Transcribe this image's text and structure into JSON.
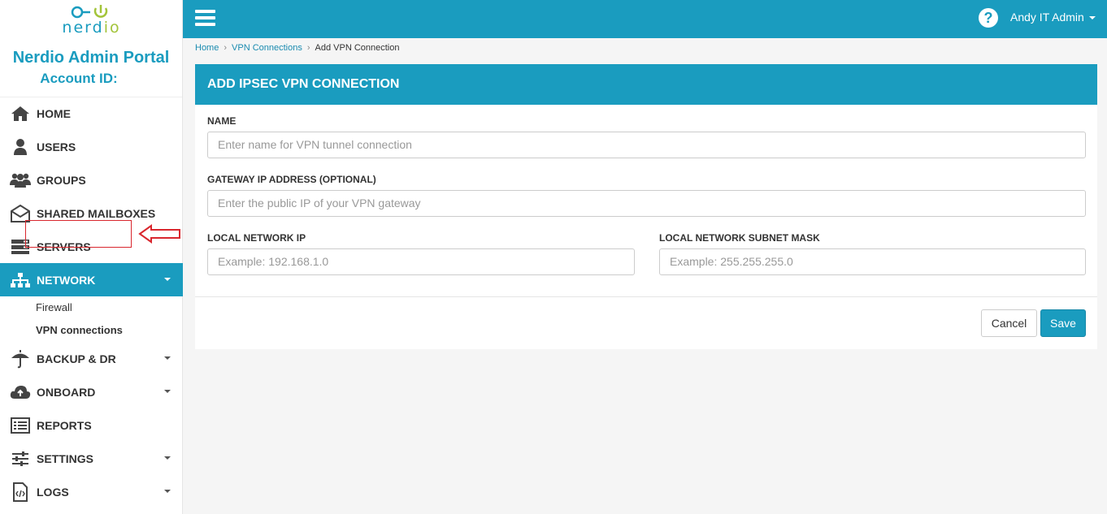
{
  "brand": {
    "logo_text_a": "nerd",
    "logo_text_b": "io",
    "portal_title": "Nerdio Admin Portal",
    "account_label": "Account ID:",
    "accent_color": "#1a9cbf",
    "logo_green": "#a3c43a"
  },
  "sidebar": {
    "items": [
      {
        "label": "HOME",
        "icon": "home-icon"
      },
      {
        "label": "USERS",
        "icon": "user-icon"
      },
      {
        "label": "GROUPS",
        "icon": "group-icon"
      },
      {
        "label": "SHARED MAILBOXES",
        "icon": "mailbox-icon"
      },
      {
        "label": "SERVERS",
        "icon": "server-icon"
      },
      {
        "label": "NETWORK",
        "icon": "network-icon",
        "active": true
      },
      {
        "label": "BACKUP & DR",
        "icon": "umbrella-icon"
      },
      {
        "label": "ONBOARD",
        "icon": "cloud-upload-icon"
      },
      {
        "label": "REPORTS",
        "icon": "report-icon"
      },
      {
        "label": "SETTINGS",
        "icon": "sliders-icon"
      },
      {
        "label": "LOGS",
        "icon": "code-file-icon"
      }
    ],
    "network_sub": [
      {
        "label": "Firewall"
      },
      {
        "label": "VPN connections",
        "selected": true
      }
    ]
  },
  "topbar": {
    "user_name": "Andy IT Admin",
    "help_glyph": "?"
  },
  "breadcrumb": {
    "home": "Home",
    "vpn": "VPN Connections",
    "current": "Add VPN Connection",
    "sep": "›"
  },
  "form": {
    "title": "ADD IPSEC VPN CONNECTION",
    "name_label": "NAME",
    "name_placeholder": "Enter name for VPN tunnel connection",
    "gateway_label": "GATEWAY IP ADDRESS (OPTIONAL)",
    "gateway_placeholder": "Enter the public IP of your VPN gateway",
    "local_ip_label": "LOCAL NETWORK IP",
    "local_ip_placeholder": "Example: 192.168.1.0",
    "subnet_label": "LOCAL NETWORK SUBNET MASK",
    "subnet_placeholder": "Example: 255.255.255.0",
    "cancel_label": "Cancel",
    "save_label": "Save"
  }
}
